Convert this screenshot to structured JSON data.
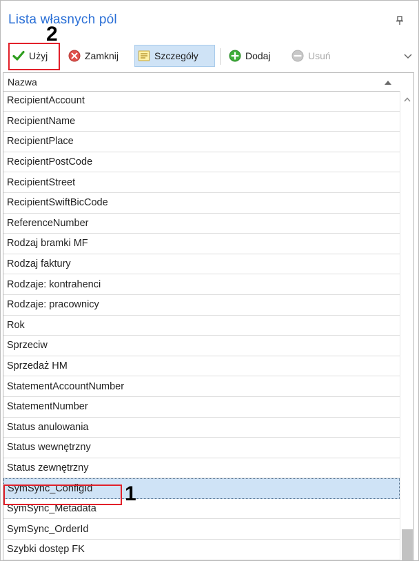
{
  "panel": {
    "title": "Lista własnych pól"
  },
  "toolbar": {
    "use_label": "Użyj",
    "close_label": "Zamknij",
    "details_label": "Szczegóły",
    "add_label": "Dodaj",
    "delete_label": "Usuń"
  },
  "annotations": {
    "marker_use": "2",
    "marker_selected": "1"
  },
  "grid": {
    "column_header": "Nazwa",
    "rows": [
      "RecipientAccount",
      "RecipientName",
      "RecipientPlace",
      "RecipientPostCode",
      "RecipientStreet",
      "RecipientSwiftBicCode",
      "ReferenceNumber",
      "Rodzaj bramki MF",
      "Rodzaj faktury",
      "Rodzaje: kontrahenci",
      "Rodzaje: pracownicy",
      "Rok",
      "Sprzeciw",
      "Sprzedaż HM",
      "StatementAccountNumber",
      "StatementNumber",
      "Status anulowania",
      "Status wewnętrzny",
      "Status zewnętrzny",
      "SymSync_ConfigId",
      "SymSync_Metadata",
      "SymSync_OrderId",
      "Szybki dostęp FK"
    ],
    "selected_row": "SymSync_ConfigId"
  },
  "colors": {
    "title": "#2a6fd6",
    "selection": "#cfe3f6",
    "annotation_red": "#e2202a"
  },
  "icons": [
    "pin-icon",
    "checkmark-icon",
    "close-circle-icon",
    "details-icon",
    "add-circle-icon",
    "remove-circle-icon",
    "chevron-down-icon",
    "sort-ascending-icon",
    "scroll-up-icon"
  ]
}
